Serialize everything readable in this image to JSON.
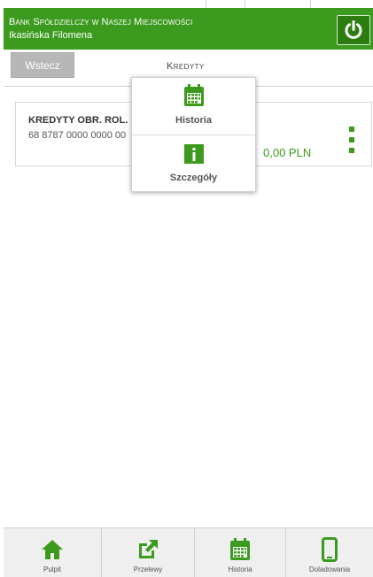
{
  "header": {
    "bank_name": "Bank Spółdzielczy w Naszej Miejscowości",
    "user_name": "Ikasińska Filomena"
  },
  "titlebar": {
    "back_label": "Wstecz",
    "title": "Kredyty"
  },
  "account": {
    "name": "KREDYTY OBR. ROL.",
    "number": "68 8787 0000 0000 00",
    "amount": "0,00 PLN"
  },
  "popup": {
    "items": [
      {
        "label": "Historia",
        "icon": "calendar-icon"
      },
      {
        "label": "Szczegóły",
        "icon": "info-icon"
      }
    ]
  },
  "bottom_nav": {
    "items": [
      {
        "label": "Pulpit",
        "icon": "home-icon"
      },
      {
        "label": "Przelewy",
        "icon": "transfer-icon"
      },
      {
        "label": "Historia",
        "icon": "calendar-icon"
      },
      {
        "label": "Doladowania",
        "icon": "phone-icon"
      }
    ]
  },
  "colors": {
    "brand_green": "#3c9a1e",
    "header_button": "#2b7d10"
  }
}
